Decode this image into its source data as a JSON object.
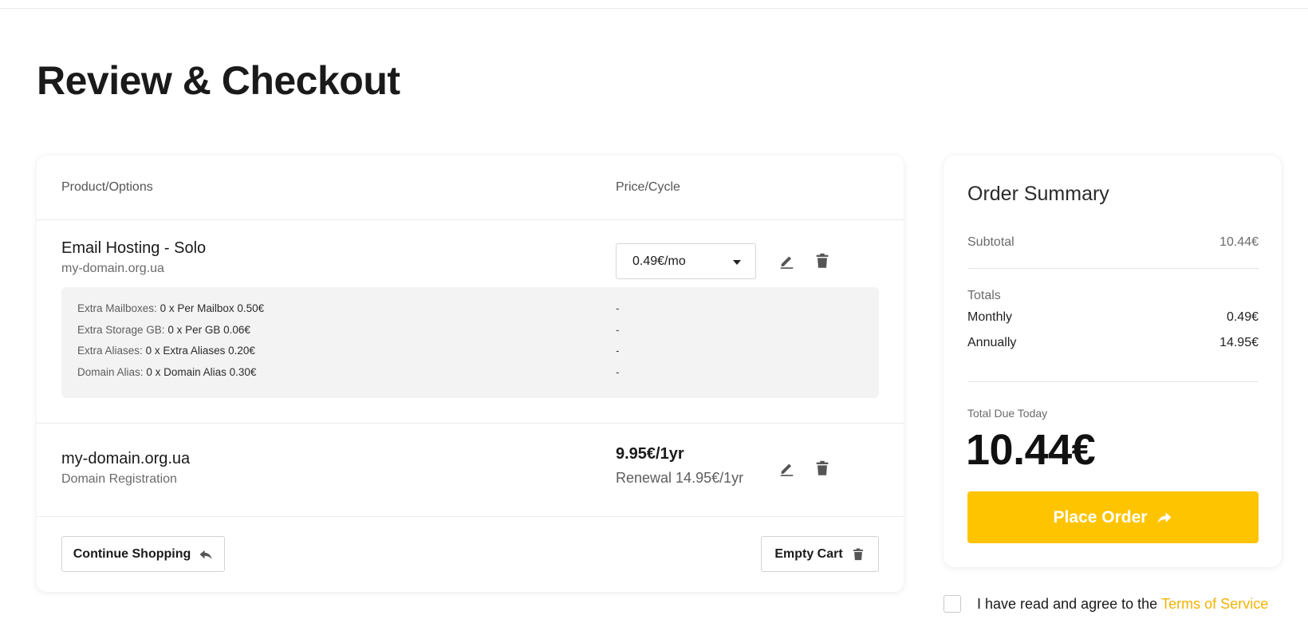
{
  "page": {
    "title": "Review & Checkout"
  },
  "cart": {
    "headers": {
      "product": "Product/Options",
      "price": "Price/Cycle"
    },
    "items": [
      {
        "name": "Email Hosting - Solo",
        "domain": "my-domain.org.ua",
        "cycle": "0.49€/mo",
        "options": [
          {
            "label": "Extra Mailboxes:",
            "value": "0 x Per Mailbox 0.50€",
            "price": "-"
          },
          {
            "label": "Extra Storage GB:",
            "value": "0 x Per GB 0.06€",
            "price": "-"
          },
          {
            "label": "Extra Aliases:",
            "value": "0 x Extra Aliases 0.20€",
            "price": "-"
          },
          {
            "label": "Domain Alias:",
            "value": "0 x Domain Alias 0.30€",
            "price": "-"
          }
        ]
      },
      {
        "name": "my-domain.org.ua",
        "type": "Domain Registration",
        "price": "9.95€/1yr",
        "renewal": "Renewal 14.95€/1yr"
      }
    ],
    "continue_label": "Continue Shopping",
    "empty_label": "Empty Cart"
  },
  "summary": {
    "title": "Order Summary",
    "subtotal_label": "Subtotal",
    "subtotal_value": "10.44€",
    "totals_label": "Totals",
    "monthly_label": "Monthly",
    "monthly_value": "0.49€",
    "annually_label": "Annually",
    "annually_value": "14.95€",
    "due_label": "Total Due Today",
    "due_value": "10.44€",
    "place_order_label": "Place Order"
  },
  "tos": {
    "text": "I have read and agree to the",
    "link": "Terms of Service"
  },
  "colors": {
    "accent": "#ffc400",
    "link": "#f2b300"
  },
  "icons": [
    "pencil-icon",
    "trash-icon",
    "reply-icon",
    "arrow-right-icon",
    "caret-down-icon"
  ]
}
